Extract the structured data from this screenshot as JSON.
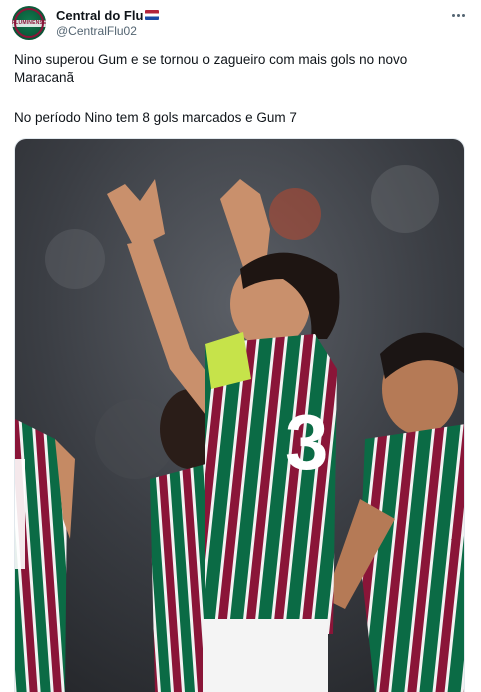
{
  "author": {
    "display_name": "Central do Flu",
    "handle": "@CentralFlu02",
    "avatar_text": "FLUMINENSE",
    "flag_icon": "hungary-flag-icon"
  },
  "menu": {
    "icon": "more-options-icon"
  },
  "tweet": {
    "line1": "Nino superou Gum e se tornou o zagueiro com mais gols no novo Maracanã",
    "line2": "No período Nino tem 8 gols marcados e Gum 7"
  },
  "media": {
    "jersey_number": "3"
  },
  "colors": {
    "grena": "#8a1538",
    "green": "#0b6b45",
    "armband": "#c6e34a"
  }
}
